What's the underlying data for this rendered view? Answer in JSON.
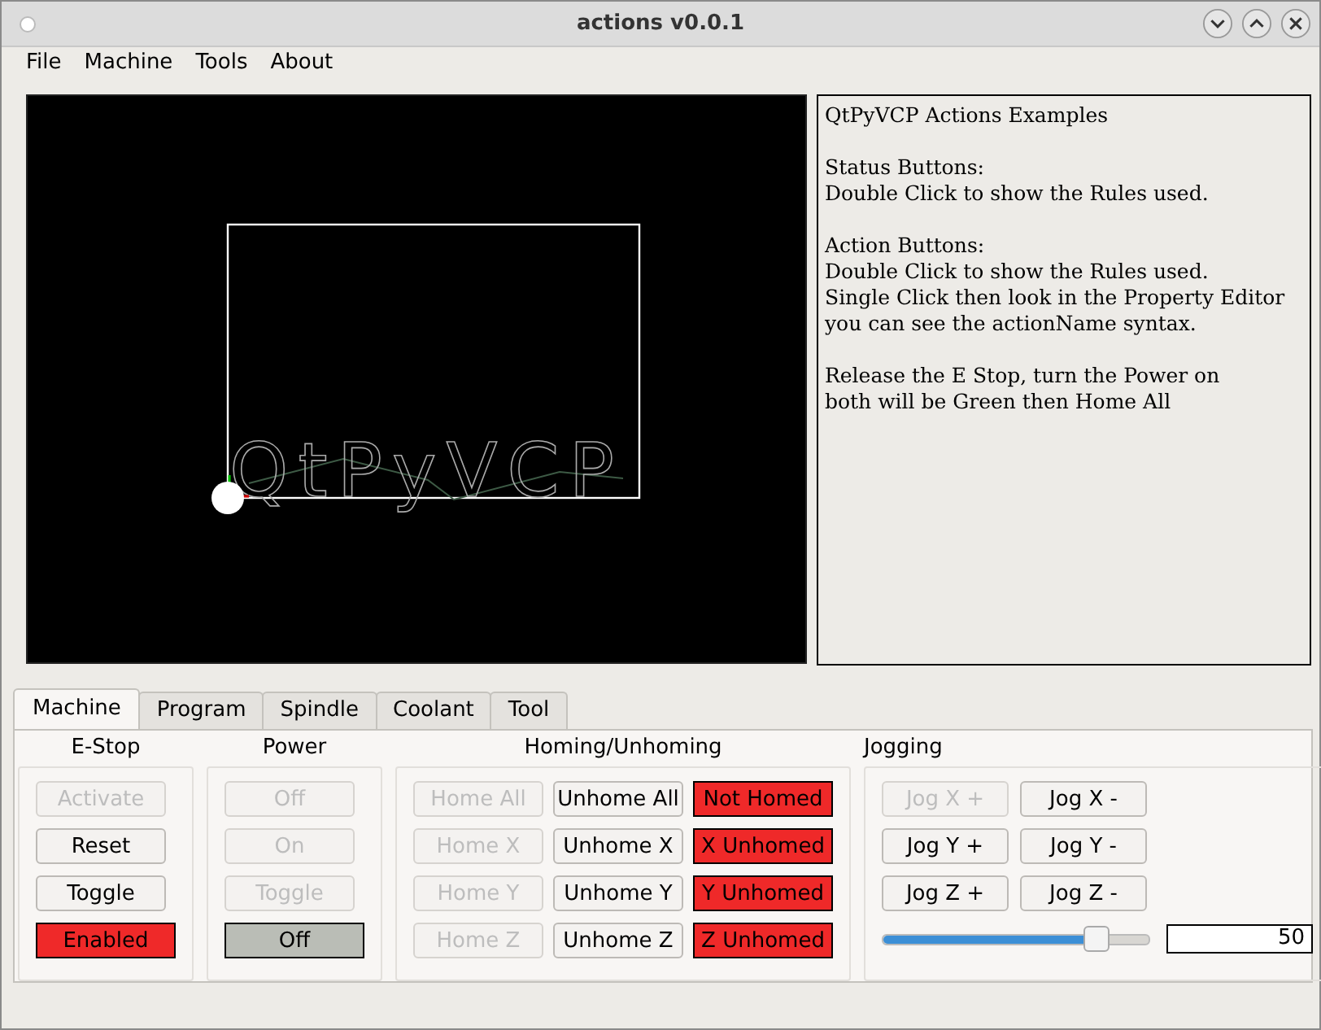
{
  "window": {
    "title": "actions v0.0.1"
  },
  "menu": [
    "File",
    "Machine",
    "Tools",
    "About"
  ],
  "backplot": {
    "engraving": "QtPyVCP"
  },
  "info": [
    "QtPyVCP Actions Examples",
    "Status Buttons:\nDouble Click to show the Rules used.",
    "Action Buttons:\nDouble Click to show the Rules used.\nSingle Click then look in the Property Editor\nyou can see the actionName syntax.",
    "Release the E Stop, turn the Power on\nboth will be Green then Home All"
  ],
  "tabs": [
    {
      "label": "Machine",
      "selected": true
    },
    {
      "label": "Program",
      "selected": false
    },
    {
      "label": "Spindle",
      "selected": false
    },
    {
      "label": "Coolant",
      "selected": false
    },
    {
      "label": "Tool",
      "selected": false
    }
  ],
  "groups": [
    {
      "title": "E-Stop",
      "columns": [
        [
          {
            "kind": "button",
            "label": "Activate",
            "disabled": true
          },
          {
            "kind": "button",
            "label": "Reset",
            "disabled": false
          },
          {
            "kind": "button",
            "label": "Toggle",
            "disabled": false
          },
          {
            "kind": "indicator",
            "label": "Enabled",
            "color": "#ef2929"
          }
        ]
      ]
    },
    {
      "title": "Power",
      "columns": [
        [
          {
            "kind": "button",
            "label": "Off",
            "disabled": true
          },
          {
            "kind": "button",
            "label": "On",
            "disabled": true
          },
          {
            "kind": "button",
            "label": "Toggle",
            "disabled": true
          },
          {
            "kind": "indicator",
            "label": "Off",
            "color": "#babdb6"
          }
        ]
      ]
    },
    {
      "title": "Homing/Unhoming",
      "columns": [
        [
          {
            "kind": "button",
            "label": "Home All",
            "disabled": true
          },
          {
            "kind": "button",
            "label": "Home X",
            "disabled": true
          },
          {
            "kind": "button",
            "label": "Home Y",
            "disabled": true
          },
          {
            "kind": "button",
            "label": "Home Z",
            "disabled": true
          }
        ],
        [
          {
            "kind": "button",
            "label": "Unhome All",
            "disabled": false
          },
          {
            "kind": "button",
            "label": "Unhome X",
            "disabled": false
          },
          {
            "kind": "button",
            "label": "Unhome Y",
            "disabled": false
          },
          {
            "kind": "button",
            "label": "Unhome Z",
            "disabled": false
          }
        ],
        [
          {
            "kind": "indicator",
            "label": "Not Homed",
            "color": "#ef2929"
          },
          {
            "kind": "indicator",
            "label": "X Unhomed",
            "color": "#ef2929"
          },
          {
            "kind": "indicator",
            "label": "Y Unhomed",
            "color": "#ef2929"
          },
          {
            "kind": "indicator",
            "label": "Z Unhomed",
            "color": "#ef2929"
          }
        ]
      ]
    },
    {
      "title": "Jogging",
      "columns": [
        [
          {
            "kind": "button",
            "label": "Jog X +",
            "disabled": true
          },
          {
            "kind": "button",
            "label": "Jog Y +",
            "disabled": false
          },
          {
            "kind": "button",
            "label": "Jog Z +",
            "disabled": false
          }
        ],
        [
          {
            "kind": "button",
            "label": "Jog X -",
            "disabled": false
          },
          {
            "kind": "button",
            "label": "Jog Y -",
            "disabled": false
          },
          {
            "kind": "button",
            "label": "Jog Z -",
            "disabled": false
          }
        ]
      ],
      "slider": {
        "level": 0.8,
        "value": "50"
      }
    }
  ]
}
